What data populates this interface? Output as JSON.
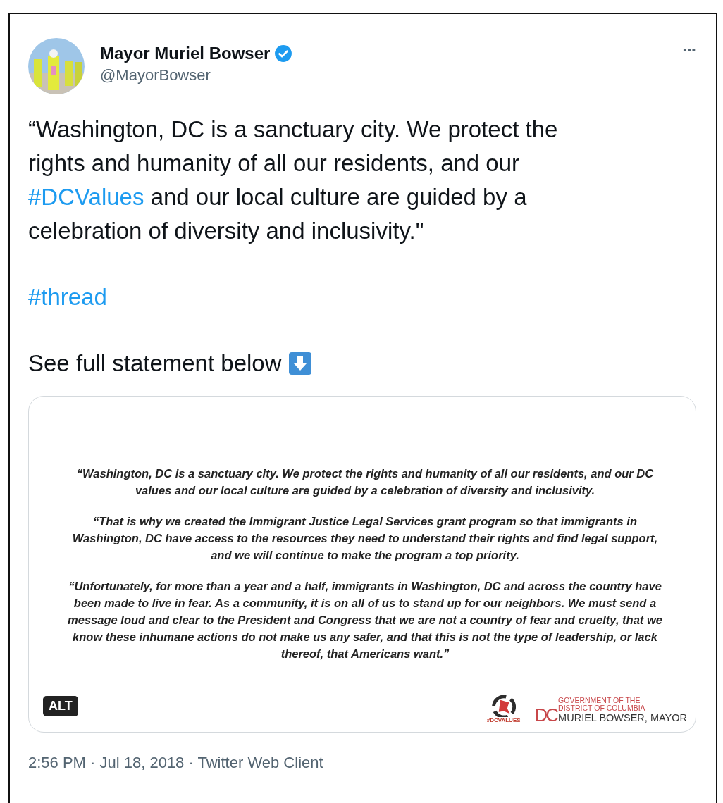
{
  "author": {
    "name": "Mayor Muriel Bowser",
    "verified": true,
    "handle": "@MayorBowser"
  },
  "more_menu": "•••",
  "tweet_text": [
    {
      "kind": "text",
      "text": "“Washington, DC is a sanctuary city. We protect the rights and humanity of all our residents, and our "
    },
    {
      "kind": "hashtag",
      "text": "#DCValues"
    },
    {
      "kind": "text",
      "text": " and our local culture are guided by a celebration of diversity and inclusivity.\""
    }
  ],
  "thread_tag": "#thread",
  "see_full": "See full statement below",
  "attached_image": {
    "paragraphs": [
      "“Washington, DC is a sanctuary city. We protect the rights and humanity of all our residents, and our DC values and our local culture are guided by a celebration of diversity and inclusivity.",
      "“That is why we created the Immigrant Justice Legal Services grant program so that immigrants in Washington, DC have access to the resources they need to understand their rights and find legal support, and we will continue to make the program a top priority.",
      "“Unfortunately, for more than a year and a half, immigrants in Washington, DC and across the country have been made to live in fear. As a community, it is on all of us to stand up for our neighbors. We must send a message loud and clear to the President and Congress that we are not a country of fear and cruelty, that we know these inhumane actions do not make us any safer, and that this is not the type of leadership, or lack thereof, that Americans want.”"
    ],
    "alt_badge": "ALT",
    "values_logo_text": "#DCVALUES",
    "gov_logo": {
      "mark": "DC",
      "lines": [
        "GOVERNMENT OF THE",
        "DISTRICT OF COLUMBIA",
        "MURIEL BOWSER, MAYOR"
      ]
    }
  },
  "timestamp": "2:56 PM · Jul 18, 2018 · Twitter Web Client"
}
